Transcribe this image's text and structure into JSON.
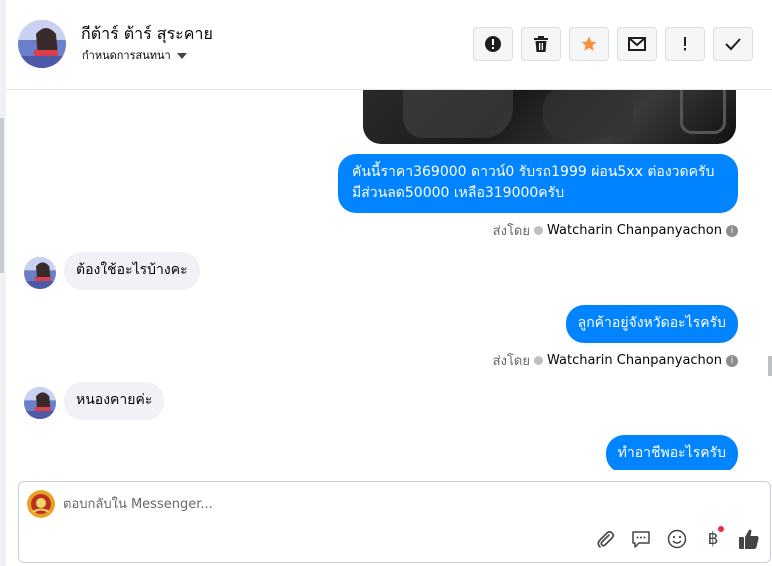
{
  "header": {
    "contact_name": "กีต้าร์ ต้าร์ สุระคาย",
    "subtitle": "กำหนดการสนทนา",
    "tools": [
      {
        "name": "alert-icon",
        "label": "!"
      },
      {
        "name": "trash-icon",
        "label": ""
      },
      {
        "name": "star-icon",
        "label": ""
      },
      {
        "name": "mail-icon",
        "label": ""
      },
      {
        "name": "exclamation-icon",
        "label": "!"
      },
      {
        "name": "checkmark-icon",
        "label": ""
      }
    ]
  },
  "messages": {
    "m1": "คันนี้ราคา369000 ดาวน์0   รับรถ1999 ผ่อน5xx ต่องวดครับ",
    "m1b": "มีส่วนลด50000 เหลือ319000ครับ",
    "sent1_prefix": "ส่งโดย",
    "sent1_name": "Watcharin Chanpanyachon",
    "m2": "ต้องใช้อะไรบ้างคะ",
    "m3": "ลูกค้าอยู่จังหวัดอะไรครับ",
    "sent2_prefix": "ส่งโดย",
    "sent2_name": "Watcharin Chanpanyachon",
    "m4": "หนองคายค่ะ",
    "m5": "ทำอาชีพอะไรครับ"
  },
  "composer": {
    "placeholder": "ตอบกลับใน Messenger...",
    "icons": [
      "attachment-icon",
      "quick-reply-icon",
      "emoji-icon",
      "baht-icon",
      "thumbs-up-icon"
    ],
    "baht_glyph": "฿"
  },
  "colors": {
    "accent": "#0084ff",
    "incoming": "#f0f2f5",
    "star": "#f7923a"
  }
}
